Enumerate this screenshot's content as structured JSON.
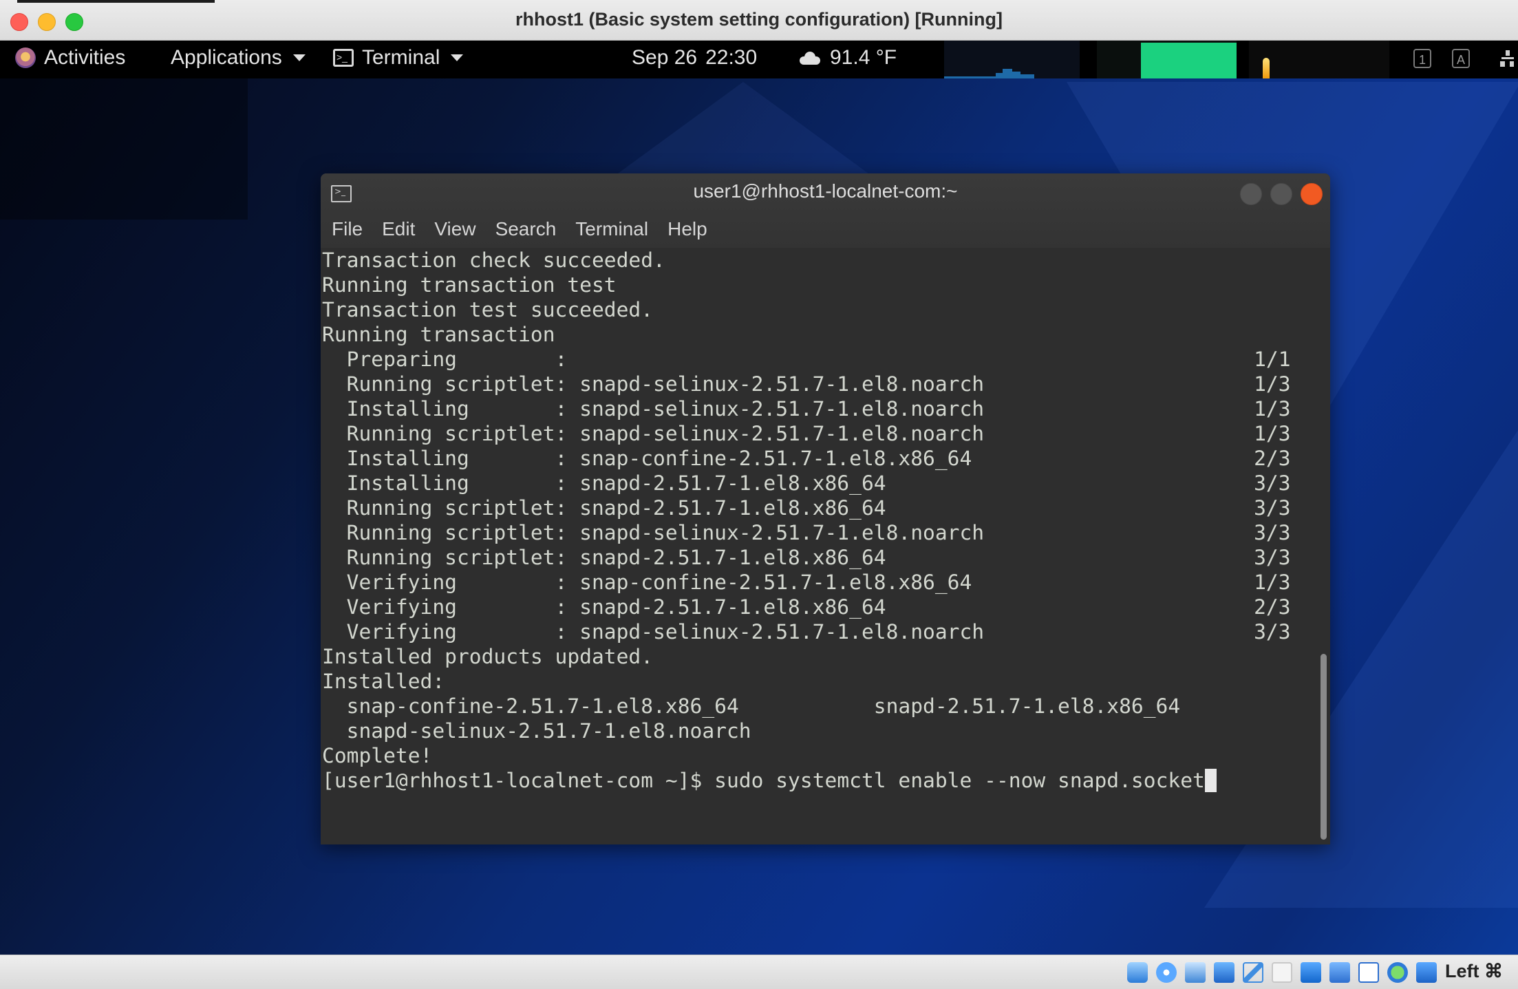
{
  "host_window": {
    "title": "rhhost1 (Basic system setting configuration) [Running]"
  },
  "topbar": {
    "activities": "Activities",
    "applications": "Applications",
    "terminal_menu": "Terminal",
    "date": "Sep 26",
    "time": "22:30",
    "weather": "91.4 °F",
    "kbd_indicator_1": "1",
    "kbd_indicator_2": "A"
  },
  "terminal": {
    "title": "user1@rhhost1-localnet-com:~",
    "menu": [
      "File",
      "Edit",
      "View",
      "Search",
      "Terminal",
      "Help"
    ],
    "lines": [
      "Transaction check succeeded.",
      "Running transaction test",
      "Transaction test succeeded.",
      "Running transaction",
      "  Preparing        :                                                        1/1",
      "  Running scriptlet: snapd-selinux-2.51.7-1.el8.noarch                      1/3",
      "  Installing       : snapd-selinux-2.51.7-1.el8.noarch                      1/3",
      "  Running scriptlet: snapd-selinux-2.51.7-1.el8.noarch                      1/3",
      "  Installing       : snap-confine-2.51.7-1.el8.x86_64                       2/3",
      "  Installing       : snapd-2.51.7-1.el8.x86_64                              3/3",
      "  Running scriptlet: snapd-2.51.7-1.el8.x86_64                              3/3",
      "  Running scriptlet: snapd-selinux-2.51.7-1.el8.noarch                      3/3",
      "  Running scriptlet: snapd-2.51.7-1.el8.x86_64                              3/3",
      "  Verifying        : snap-confine-2.51.7-1.el8.x86_64                       1/3",
      "  Verifying        : snapd-2.51.7-1.el8.x86_64                              2/3",
      "  Verifying        : snapd-selinux-2.51.7-1.el8.noarch                      3/3",
      "Installed products updated.",
      "",
      "Installed:",
      "  snap-confine-2.51.7-1.el8.x86_64           snapd-2.51.7-1.el8.x86_64",
      "  snapd-selinux-2.51.7-1.el8.noarch",
      "",
      "Complete!"
    ],
    "prompt": "[user1@rhhost1-localnet-com ~]$ ",
    "command": "sudo systemctl enable --now snapd.socket"
  },
  "statusbar": {
    "icons": [
      "hard-disk-icon",
      "optical-drive-icon",
      "audio-icon",
      "network-icon",
      "usb-icon",
      "shared-folder-icon",
      "display-icon",
      "video-capture-icon",
      "vt-x-icon",
      "mouse-integration-icon",
      "arrow-down-icon"
    ],
    "host_key": "Left ⌘"
  },
  "colors": {
    "terminal_bg": "#2e2e2e",
    "terminal_fg": "#d3d7cf",
    "close_button": "#f15a22",
    "memory_graph": "#1bd17f",
    "cpu_graph": "#1e6aa8"
  }
}
